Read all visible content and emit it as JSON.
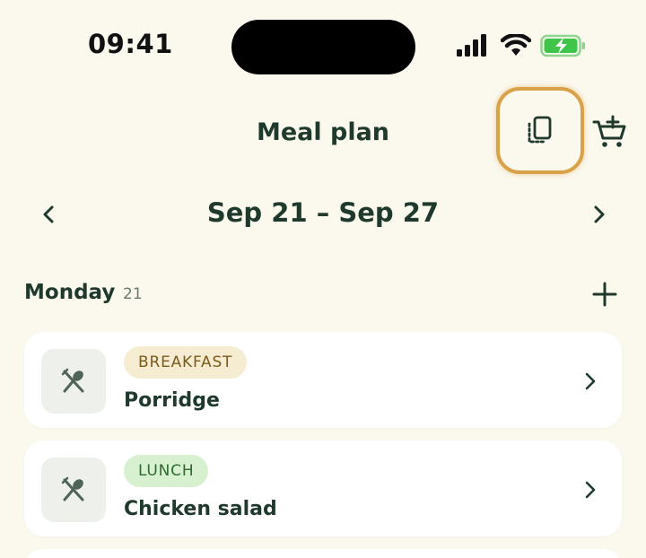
{
  "status_bar": {
    "time": "09:41",
    "icons": [
      "cellular-signal-icon",
      "wifi-icon",
      "battery-charging-icon"
    ]
  },
  "header": {
    "title": "Meal plan",
    "highlighted_button_icon": "copy-week-icon",
    "cart_icon": "add-to-cart-icon"
  },
  "week": {
    "range": "Sep 21 – Sep 27",
    "prev_icon": "chevron-left-icon",
    "next_icon": "chevron-right-icon"
  },
  "day": {
    "name": "Monday",
    "number": "21",
    "add_icon": "plus-icon"
  },
  "meals": [
    {
      "tag": "BREAKFAST",
      "name": "Porridge",
      "icon": "fork-spoon-icon"
    },
    {
      "tag": "LUNCH",
      "name": "Chicken salad",
      "icon": "fork-spoon-icon"
    }
  ],
  "colors": {
    "background": "#fbf8ee",
    "primary_text": "#1f3a2c",
    "highlight_ring": "#d9a248",
    "breakfast_tag_bg": "#f6ecd2",
    "lunch_tag_bg": "#d7f0cf",
    "battery_green": "#3fc64a"
  }
}
